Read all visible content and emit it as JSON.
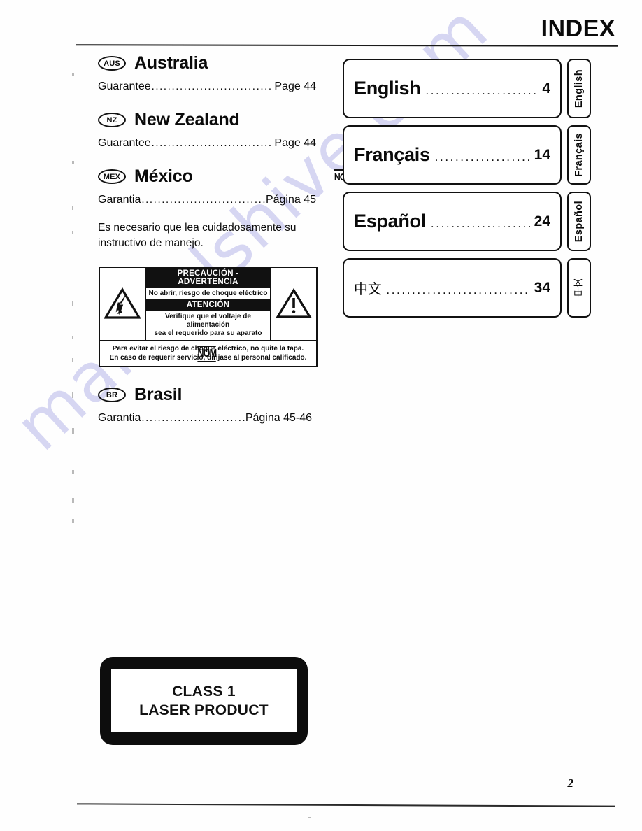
{
  "header": {
    "title": "INDEX"
  },
  "footer": {
    "page_number": "2"
  },
  "watermark": {
    "text": "manualshive.com",
    "color": "#d6d6f2"
  },
  "left_column": {
    "countries": [
      {
        "code": "AUS",
        "name": "Australia",
        "entry_label": "Guarantee",
        "entry_leader": "......................................................",
        "entry_page": "Page 44",
        "nom": null
      },
      {
        "code": "NZ",
        "name": "New Zealand",
        "entry_label": "Guarantee",
        "entry_leader": "......................................................",
        "entry_page": "Page 44",
        "nom": null
      },
      {
        "code": "MEX",
        "name": "México",
        "entry_label": "Garantia",
        "entry_leader": "......................................................",
        "entry_page": "Página 45",
        "nom": "NOM"
      }
    ],
    "mex_instruction": "Es necesario que lea cuidadosamente su instructivo de manejo.",
    "warning_label": {
      "heading": "PRECAUCIÓN - ADVERTENCIA",
      "subheading": "No abrir, riesgo de choque eléctrico",
      "attention_heading": "ATENCIÓN",
      "attention_line1": "Verifique que el voltaje de alimentación",
      "attention_line2": "sea el requerido para su aparato",
      "bottom_line1": "Para evitar el riesgo de choque eléctrico, no quite la tapa.",
      "bottom_line2": "En caso de requerir servicio, dirijase al personal calificado.",
      "left_icon": "lightning-bolt-triangle-icon",
      "right_icon": "exclamation-triangle-icon"
    },
    "nom_mark": "NOM",
    "brasil": {
      "code": "BR",
      "name": "Brasil",
      "entry_label": "Garantia",
      "entry_leader": "......................................................",
      "entry_page": "Página 45-46"
    },
    "laser_label": {
      "line1": "CLASS 1",
      "line2": "LASER PRODUCT"
    }
  },
  "right_column": {
    "languages": [
      {
        "name": "English",
        "leader": "..........................................",
        "page": "4",
        "tab_label": "English",
        "cjk": false
      },
      {
        "name": "Français",
        "leader": "..........................................",
        "page": "14",
        "tab_label": "Français",
        "cjk": false
      },
      {
        "name": "Español",
        "leader": "..........................................",
        "page": "24",
        "tab_label": "Español",
        "cjk": false
      },
      {
        "name": "中文",
        "leader": "..........................................",
        "page": "34",
        "tab_label": "中文",
        "cjk": true
      }
    ]
  }
}
